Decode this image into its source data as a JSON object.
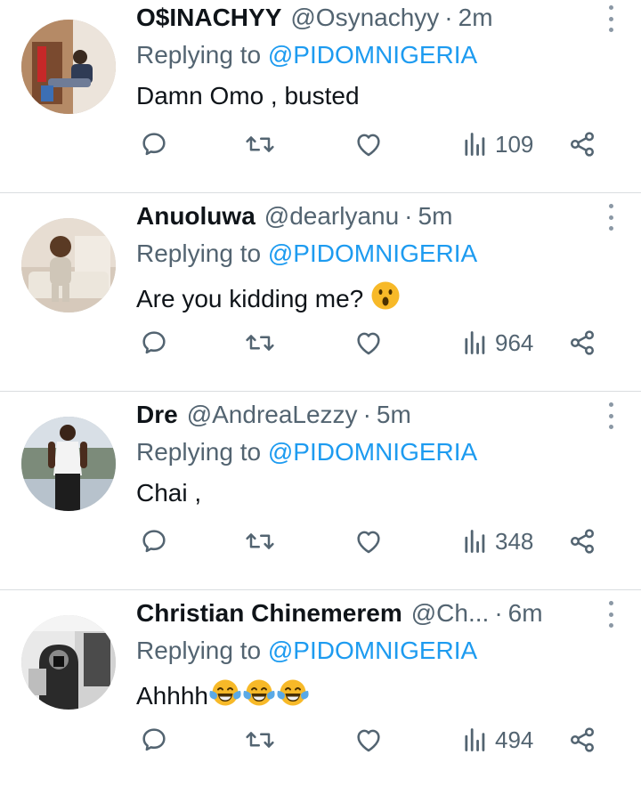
{
  "replying_label": "Replying to",
  "tweets": [
    {
      "name": "O$INACHYY",
      "handle": "@Osynachyy",
      "separator": "·",
      "time": "2m",
      "mention": "@PIDOMNIGERIA",
      "text": "Damn Omo , busted",
      "emojis": [],
      "views": "109",
      "avatar_icon": "avatar-man-sitting"
    },
    {
      "name": "Anuoluwa",
      "handle": "@dearlyanu",
      "separator": "·",
      "time": "5m",
      "mention": "@PIDOMNIGERIA",
      "text": "Are you kidding me?",
      "emojis": [
        "hushed-face-emoji"
      ],
      "views": "964",
      "avatar_icon": "avatar-baby"
    },
    {
      "name": "Dre",
      "handle": "@AndreaLezzy",
      "separator": "·",
      "time": "5m",
      "mention": "@PIDOMNIGERIA",
      "text": "Chai ,",
      "emojis": [],
      "views": "348",
      "avatar_icon": "avatar-man-tank-top"
    },
    {
      "name": "Christian Chinemerem",
      "handle": "@Ch...",
      "separator": "·",
      "time": "6m",
      "mention": "@PIDOMNIGERIA",
      "text": "Ahhhh",
      "emojis": [
        "tears-of-joy-emoji",
        "tears-of-joy-emoji",
        "tears-of-joy-emoji"
      ],
      "views": "494",
      "avatar_icon": "avatar-hooded-selfie"
    }
  ],
  "colors": {
    "text": "#0f1419",
    "secondary": "#536471",
    "link": "#1d9bf0",
    "divider": "#dadde0",
    "emoji_yellow": "#f7b928"
  }
}
